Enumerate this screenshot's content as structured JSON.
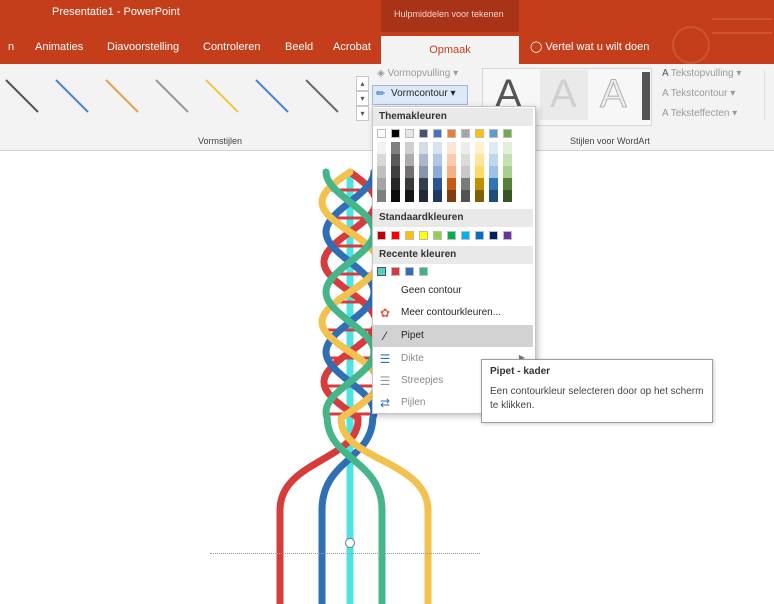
{
  "window": {
    "title": "Presentatie1  -  PowerPoint",
    "contextual_tab_group": "Hulpmiddelen voor tekenen"
  },
  "tabs": [
    {
      "label": "n"
    },
    {
      "label": "Animaties"
    },
    {
      "label": "Diavoorstelling"
    },
    {
      "label": "Controleren"
    },
    {
      "label": "Beeld"
    },
    {
      "label": "Acrobat"
    },
    {
      "label": "Opmaak",
      "active": true
    }
  ],
  "tell_me": "Vertel wat u wilt doen",
  "ribbon": {
    "shape_styles_group": "Vormstijlen",
    "wordart_group": "Stijlen voor WordArt",
    "vormopvulling": "Vormopvulling",
    "vormcontour": "Vormcontour",
    "tekstopvulling": "Tekstopvulling",
    "tekstcontour": "Tekstcontour",
    "teksteffecten": "Teksteffecten",
    "wordart_letter": "A",
    "line_style_colors": [
      "#555555",
      "#4a86c8",
      "#e0a24a",
      "#9a9a9a",
      "#f0c44a",
      "#4a86c8",
      "#6a6a6a"
    ]
  },
  "dropdown": {
    "theme_header": "Themakleuren",
    "standard_header": "Standaardkleuren",
    "recent_header": "Recente kleuren",
    "theme_top": [
      "#ffffff",
      "#000000",
      "#e7e6e6",
      "#44546a",
      "#4472c4",
      "#ed7d31",
      "#a5a5a5",
      "#ffc000",
      "#5b9bd5",
      "#70ad47"
    ],
    "theme_shades": [
      [
        "#f2f2f2",
        "#7f7f7f",
        "#d0cece",
        "#d6dce4",
        "#d9e2f3",
        "#fbe5d5",
        "#ededed",
        "#fff2cc",
        "#deebf6",
        "#e2efd9"
      ],
      [
        "#d8d8d8",
        "#595959",
        "#aeabab",
        "#adb9ca",
        "#b4c6e7",
        "#f7cbac",
        "#dbdbdb",
        "#fee599",
        "#bdd7ee",
        "#c5e0b3"
      ],
      [
        "#bfbfbf",
        "#3f3f3f",
        "#757070",
        "#8496b0",
        "#8eaadb",
        "#f4b183",
        "#c9c9c9",
        "#ffd965",
        "#9cc3e5",
        "#a8d08d"
      ],
      [
        "#a5a5a5",
        "#262626",
        "#3a3838",
        "#323f4f",
        "#2f5496",
        "#c55a11",
        "#7b7b7b",
        "#bf9000",
        "#2e75b5",
        "#538135"
      ],
      [
        "#7f7f7f",
        "#0c0c0c",
        "#171616",
        "#222a35",
        "#1f3864",
        "#833c0b",
        "#525252",
        "#7f6000",
        "#1e4e79",
        "#375623"
      ]
    ],
    "standard": [
      "#c00000",
      "#ff0000",
      "#ffc000",
      "#ffff00",
      "#92d050",
      "#00b050",
      "#00b0f0",
      "#0070c0",
      "#002060",
      "#7030a0"
    ],
    "recent": [
      "#4fd1c5",
      "#d23c3c",
      "#2f6fb5",
      "#3fb28a"
    ],
    "items": [
      {
        "label": "Geen contour",
        "icon": "none"
      },
      {
        "label": "Meer contourkleuren...",
        "icon": "palette-icon"
      },
      {
        "label": "Pipet",
        "icon": "eyedropper-icon",
        "hover": true
      },
      {
        "label": "Dikte",
        "icon": "line-weight-icon"
      },
      {
        "label": "Streepjes",
        "icon": "dashes-icon"
      },
      {
        "label": "Pijlen",
        "icon": "arrows-icon"
      }
    ]
  },
  "tooltip": {
    "title": "Pipet - kader",
    "body": "Een contourkleur selecteren door op het scherm te klikken."
  },
  "canvas": {
    "strand_colors": {
      "red": "#d63c3c",
      "blue": "#2f6fb5",
      "yellow": "#f2c14e",
      "green": "#46b58a",
      "cyan": "#4ee3e3"
    }
  }
}
